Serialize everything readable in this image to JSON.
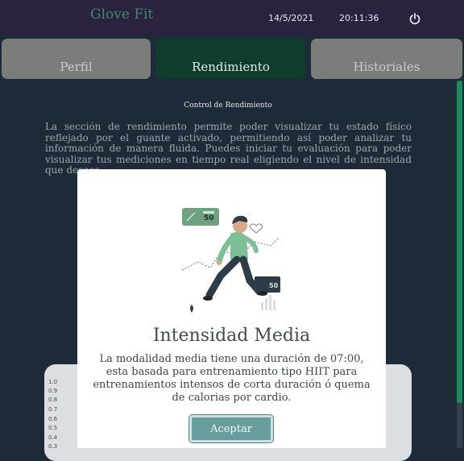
{
  "header": {
    "brand": "Glove Fit",
    "date": "14/5/2021",
    "time": "20:11:36",
    "power_icon": "power-icon"
  },
  "tabs": [
    {
      "label": "Perfil",
      "active": false
    },
    {
      "label": "Rendimiento",
      "active": true
    },
    {
      "label": "Historiales",
      "active": false
    }
  ],
  "content": {
    "title": "Control de Rendimiento",
    "text": "La sección de rendimiento permite poder visualizar tu estado físico reflejado por el guante activado, permitiendo así poder analizar tu información de manera fluida. Puedes iniciar tu evaluación para poder visualizar tus mediciones en tiempo real eligiendo el nivel de intensidad que desees"
  },
  "chart_ticks": [
    "1.0",
    "0.9",
    "0.8",
    "0.7",
    "0.6",
    "0.5",
    "0.4",
    "0.3"
  ],
  "modal": {
    "title": "Intensidad Media",
    "text": "La modalidad media tiene una duración de 07:00, esta basada para entrenamiento tipo HIIT para entrenamientos intensos de corta duración ó quema de calorias por cardio.",
    "accept_label": "Aceptar",
    "badge_value_1": "50",
    "badge_value_2": "50"
  },
  "colors": {
    "background": "#1d2b38",
    "topbar": "#2b2240",
    "brand": "#3a8f6a",
    "tab_active": "#0f3d2b",
    "tab_inactive": "#7b7d7b",
    "accept_button": "#679d9c"
  }
}
